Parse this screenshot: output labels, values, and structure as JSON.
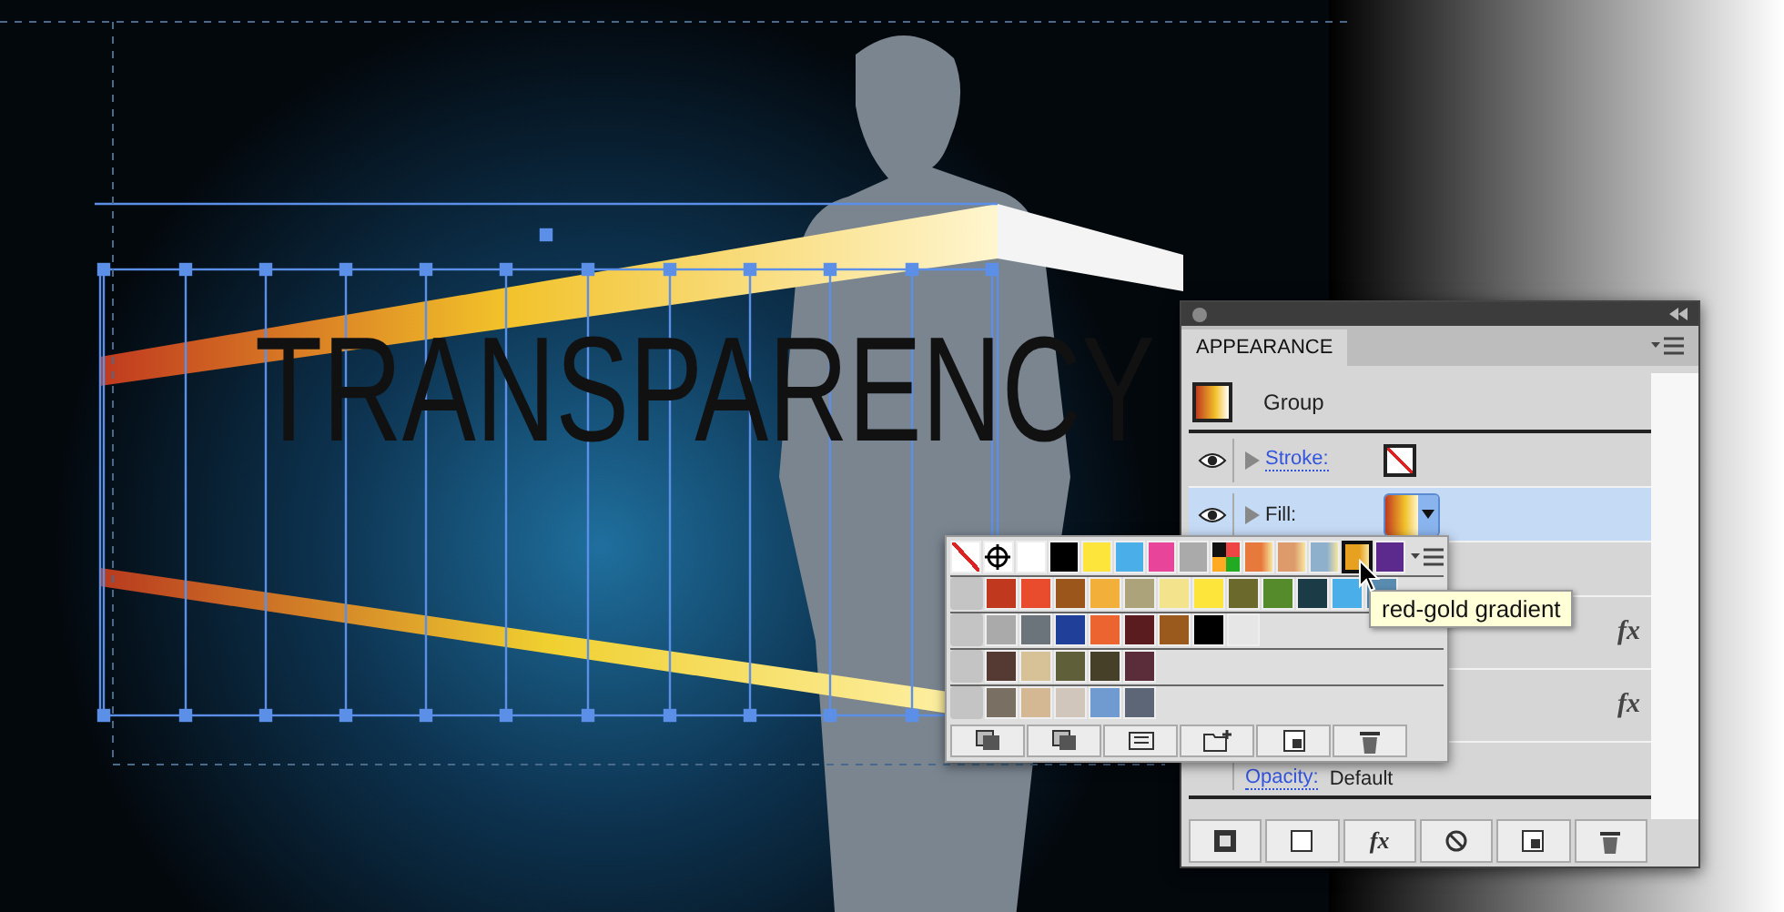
{
  "canvas": {
    "headline": "TRANSPARENCY"
  },
  "appearance_panel": {
    "tab": {
      "label": "APPEARANCE",
      "selected": true
    },
    "header": {
      "label": "Group"
    },
    "rows": [
      {
        "kind": "stroke",
        "label": "Stroke:",
        "visible": true,
        "selected": false
      },
      {
        "kind": "fill",
        "label": "Fill:",
        "visible": true,
        "selected": true
      },
      {
        "kind": "blank"
      },
      {
        "kind": "effect",
        "label": "fx"
      },
      {
        "kind": "effect",
        "label": "fx"
      },
      {
        "kind": "opacity",
        "label": "Opacity:",
        "value": "Default"
      }
    ],
    "toolbar": [
      {
        "kind": "new-art"
      },
      {
        "kind": "square"
      },
      {
        "kind": "fx",
        "label": "fx"
      },
      {
        "kind": "clear"
      },
      {
        "kind": "duplicate"
      },
      {
        "kind": "delete"
      }
    ]
  },
  "swatch_popup": {
    "tooltip": "red-gold gradient",
    "top_row": [
      {
        "kind": "none",
        "selected": false
      },
      {
        "kind": "registration",
        "selected": false
      },
      {
        "kind": "solid",
        "color": "#ffffff",
        "selected": false
      },
      {
        "kind": "solid",
        "color": "#000000",
        "selected": false
      },
      {
        "kind": "solid",
        "color": "#fde53b",
        "selected": false
      },
      {
        "kind": "solid",
        "color": "#4aaee8",
        "selected": false
      },
      {
        "kind": "solid",
        "color": "#e8459a",
        "selected": false
      },
      {
        "kind": "solid",
        "color": "#aaaaaa",
        "selected": false
      },
      {
        "kind": "pattern",
        "selected": false
      },
      {
        "kind": "gradient",
        "color": "#e8793c",
        "selected": false
      },
      {
        "kind": "gradient",
        "color": "#dd9a6a",
        "selected": false
      },
      {
        "kind": "gradient",
        "color": "#8fb0cc",
        "selected": false
      },
      {
        "kind": "gradient",
        "color": "#e8a020",
        "selected": true
      },
      {
        "kind": "solid",
        "color": "#5b2a8c",
        "selected": false
      }
    ],
    "groups": [
      {
        "swatches": [
          {
            "color": "#c0391f"
          },
          {
            "color": "#e84c2c"
          },
          {
            "color": "#9b561c"
          },
          {
            "color": "#f2b03a"
          },
          {
            "color": "#aca37a"
          },
          {
            "color": "#f3e38d"
          },
          {
            "color": "#fde53b"
          },
          {
            "color": "#6b6a2c"
          },
          {
            "color": "#558b2a"
          },
          {
            "color": "#1b3b47"
          },
          {
            "color": "#4aaee8"
          },
          {
            "color": "#5a8cb0"
          }
        ]
      },
      {
        "swatches": [
          {
            "color": "#aaaaaa"
          },
          {
            "color": "#6a747a"
          },
          {
            "color": "#1f3f99"
          },
          {
            "color": "#ec6530"
          },
          {
            "color": "#5b1c20"
          },
          {
            "color": "#9a5a1e"
          },
          {
            "color": "#000000"
          },
          {
            "color": "#e6e6e6"
          }
        ]
      },
      {
        "swatches": [
          {
            "color": "#553a33"
          },
          {
            "color": "#d6c296"
          },
          {
            "color": "#5f6039"
          },
          {
            "color": "#474029"
          },
          {
            "color": "#5b2d3a"
          }
        ]
      },
      {
        "swatches": [
          {
            "color": "#796f62"
          },
          {
            "color": "#d4b894"
          },
          {
            "color": "#d0c6bb"
          },
          {
            "color": "#6f9bd0"
          },
          {
            "color": "#5d6676"
          }
        ]
      }
    ],
    "toolbar": [
      {
        "kind": "library"
      },
      {
        "kind": "kind-menu"
      },
      {
        "kind": "options"
      },
      {
        "kind": "new-group"
      },
      {
        "kind": "new-swatch"
      },
      {
        "kind": "delete"
      }
    ]
  }
}
